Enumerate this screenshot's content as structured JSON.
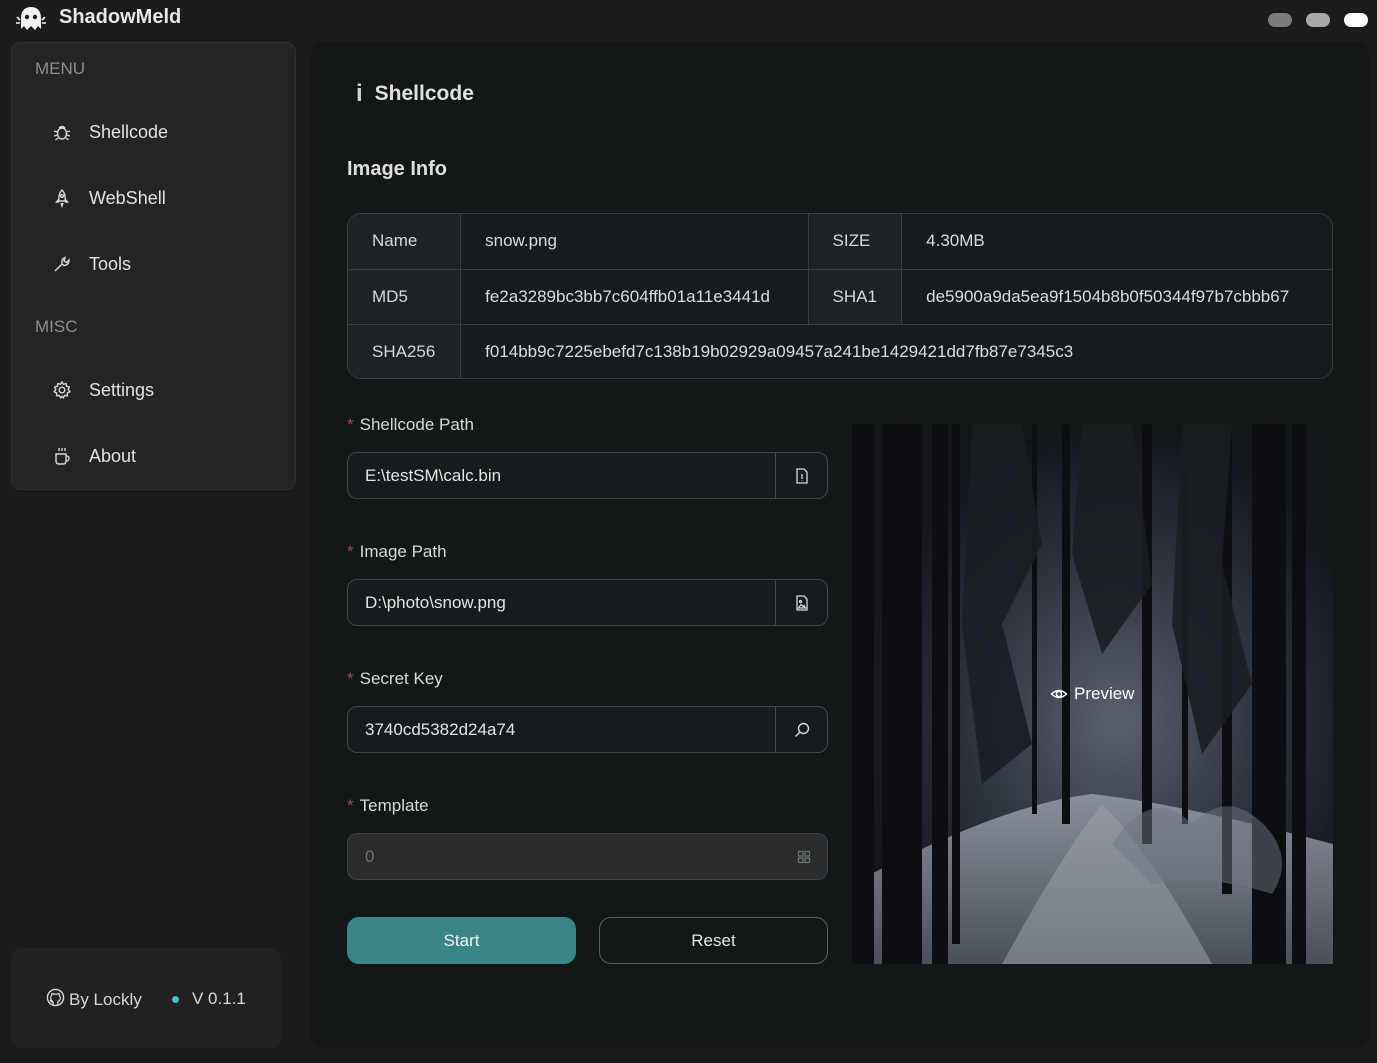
{
  "app": {
    "title": "ShadowMeld",
    "logo_icon": "ghost-icon"
  },
  "window_controls": [
    "minimize",
    "maximize",
    "close"
  ],
  "sidebar": {
    "sections": [
      {
        "title": "MENU",
        "items": [
          {
            "label": "Shellcode",
            "icon": "bug-icon"
          },
          {
            "label": "WebShell",
            "icon": "rocket-icon"
          },
          {
            "label": "Tools",
            "icon": "wrench-icon"
          }
        ]
      },
      {
        "title": "MISC",
        "items": [
          {
            "label": "Settings",
            "icon": "gear-icon"
          },
          {
            "label": "About",
            "icon": "coffee-icon"
          }
        ]
      }
    ],
    "footer": {
      "author": "By Lockly",
      "author_icon": "github-icon",
      "version": "V 0.1.1",
      "status_color": "#4cbdc1"
    }
  },
  "page": {
    "title": "Shellcode",
    "section_title": "Image Info",
    "info": {
      "name_label": "Name",
      "name_value": "snow.png",
      "size_label": "SIZE",
      "size_value": "4.30MB",
      "md5_label": "MD5",
      "md5_value": "fe2a3289bc3bb7c604ffb01a11e3441d",
      "sha1_label": "SHA1",
      "sha1_value": "de5900a9da5ea9f1504b8b0f50344f97b7cbbb67",
      "sha256_label": "SHA256",
      "sha256_value": "f014bb9c7225ebefd7c138b19b02929a09457a241be1429421dd7fb87e7345c3"
    },
    "form": {
      "required_mark": "*",
      "shellcode_path_label": "Shellcode Path",
      "shellcode_path_value": "E:\\testSM\\calc.bin",
      "image_path_label": "Image Path",
      "image_path_value": "D:\\photo\\snow.png",
      "secret_key_label": "Secret Key",
      "secret_key_value": "3740cd5382d24a74",
      "template_label": "Template",
      "template_value": "0"
    },
    "buttons": {
      "start": "Start",
      "reset": "Reset"
    },
    "preview_label": "Preview"
  },
  "colors": {
    "accent": "#3a8588",
    "required": "#b0407a",
    "background": "#1b1b1c",
    "panel": "#141718"
  }
}
